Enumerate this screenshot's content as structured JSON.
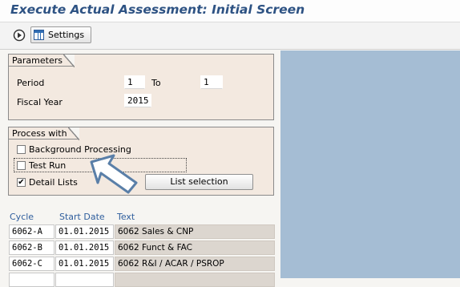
{
  "window": {
    "title": "Execute Actual Assessment: Initial Screen"
  },
  "toolbar": {
    "execute_icon": "execute-icon",
    "settings_icon": "table-settings-icon",
    "settings_label": "Settings"
  },
  "parameters": {
    "group_title": "Parameters",
    "period_label": "Period",
    "period_from": "1",
    "to_label": "To",
    "period_to": "1",
    "fiscal_year_label": "Fiscal Year",
    "fiscal_year": "2015"
  },
  "process_with": {
    "group_title": "Process with",
    "background_label": "Background Processing",
    "background_checked": false,
    "test_run_label": "Test Run",
    "test_run_checked": false,
    "detail_lists_label": "Detail Lists",
    "detail_lists_checked": true,
    "check_mark": "✔",
    "list_selection_label": "List selection"
  },
  "cycles": {
    "headers": [
      "Cycle",
      "Start Date",
      "Text"
    ],
    "rows": [
      {
        "cycle": "6062-A",
        "start_date": "01.01.2015",
        "text": "6062 Sales & CNP"
      },
      {
        "cycle": "6062-B",
        "start_date": "01.01.2015",
        "text": "6062 Funct & FAC"
      },
      {
        "cycle": "6062-C",
        "start_date": "01.01.2015",
        "text": "6062 R&I / ACAR / PSROP"
      }
    ]
  },
  "colors": {
    "title": "#2d5283",
    "header_text": "#2f5e9d",
    "right_panel": "#a5bdd4",
    "group_bg": "#f3e9e0"
  }
}
